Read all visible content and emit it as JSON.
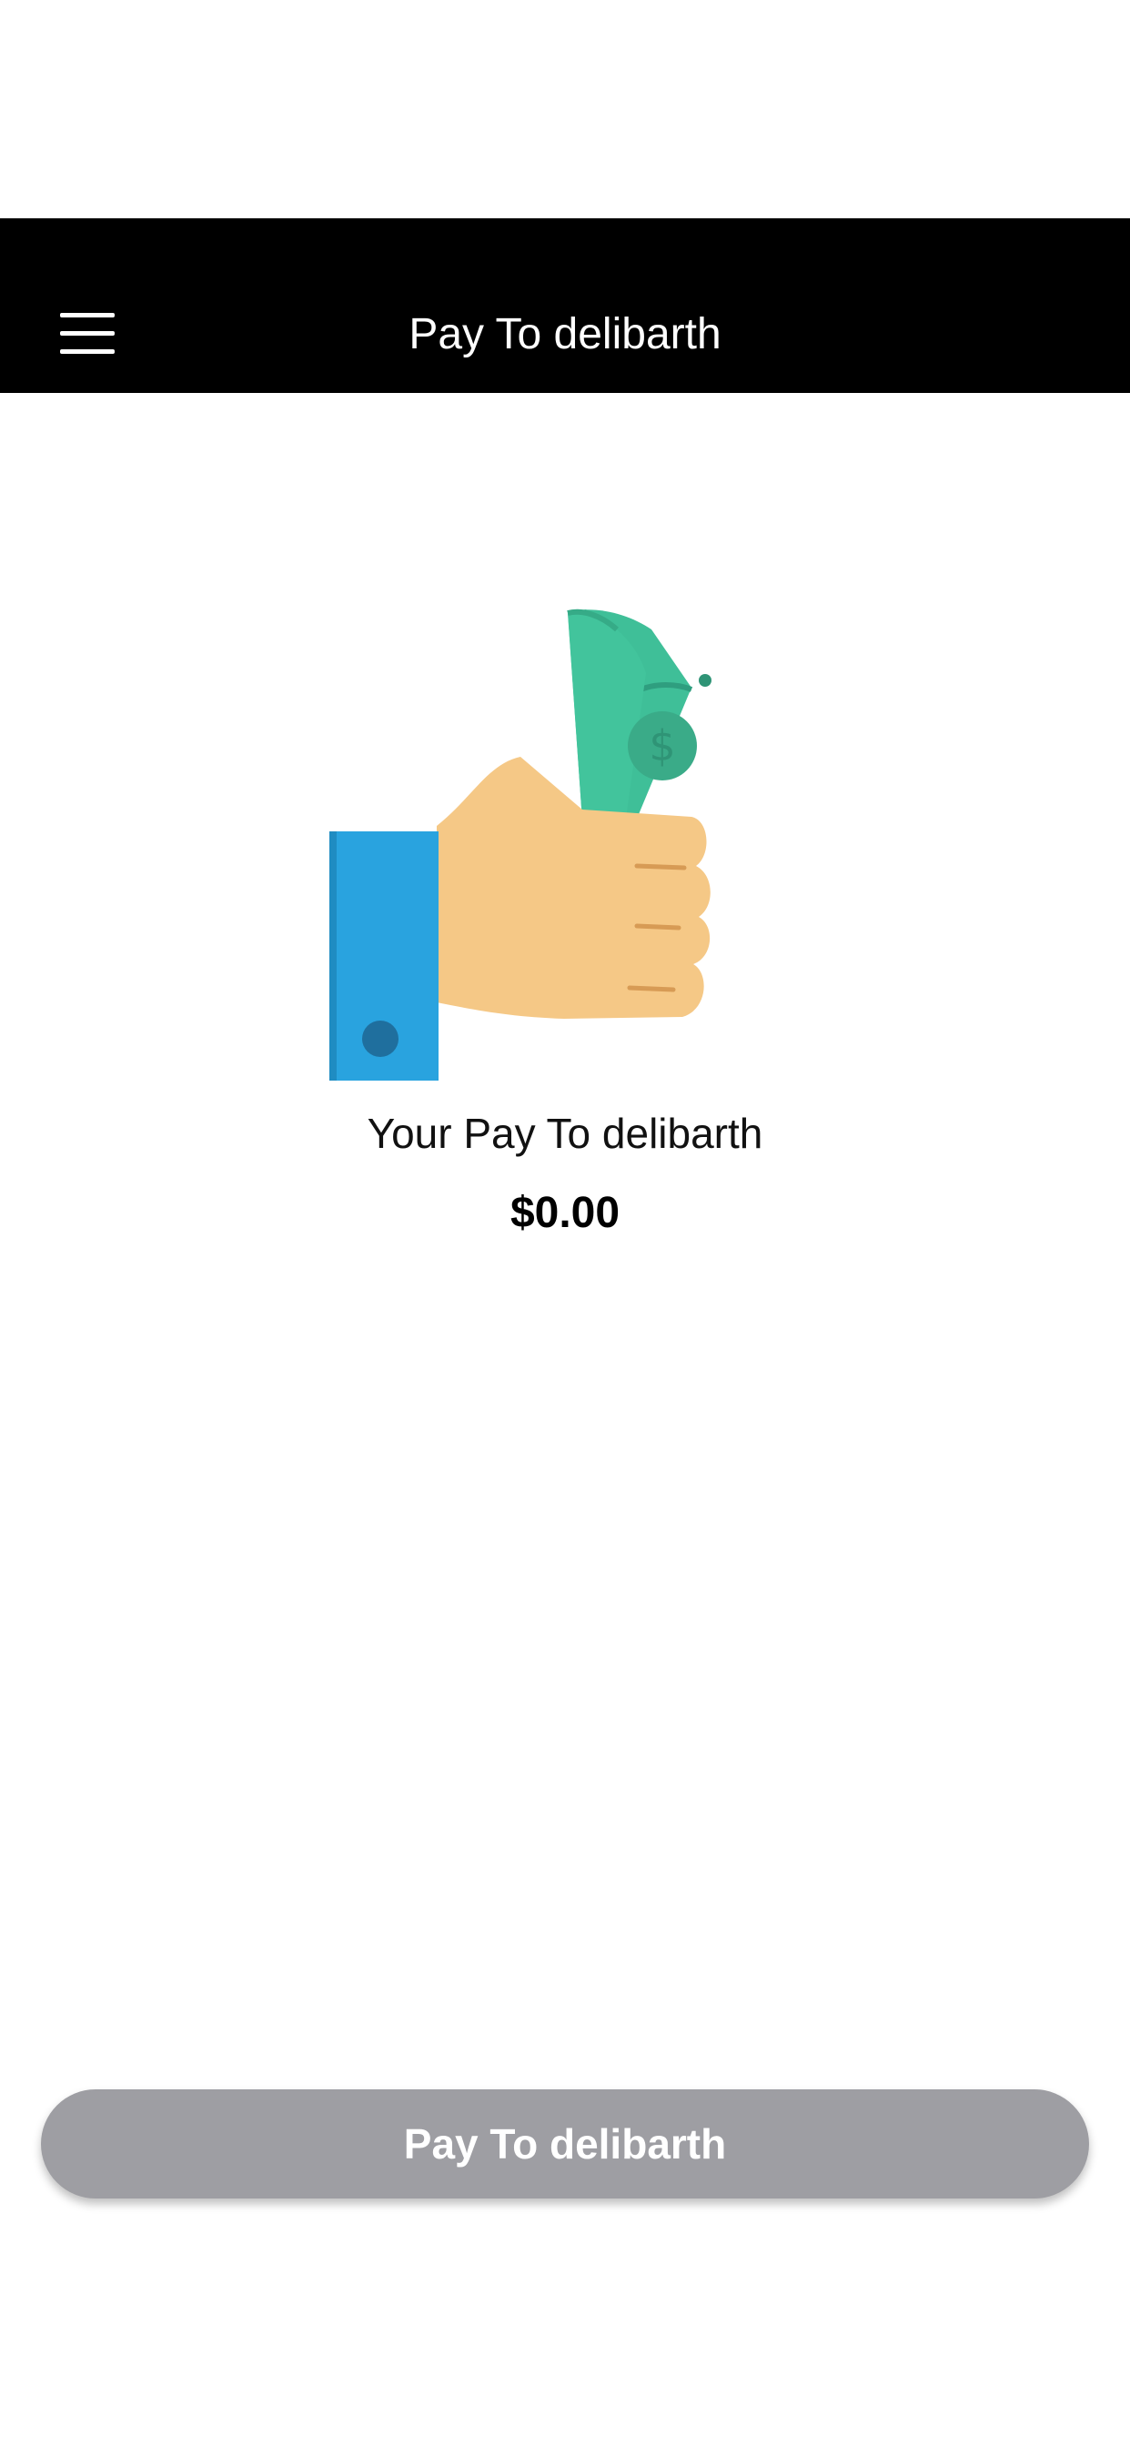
{
  "nav": {
    "title": "Pay To delibarth",
    "menu_icon": "hamburger-menu-icon"
  },
  "main": {
    "illustration": "hand-holding-money-icon",
    "label": "Your Pay To delibarth",
    "amount": "$0.00"
  },
  "footer": {
    "pay_button_label": "Pay To delibarth"
  },
  "colors": {
    "nav_background": "#000000",
    "button_disabled": "#9e9ea3",
    "cuff_blue": "#29a3df",
    "skin": "#f5c886",
    "money_green": "#40c29b"
  }
}
